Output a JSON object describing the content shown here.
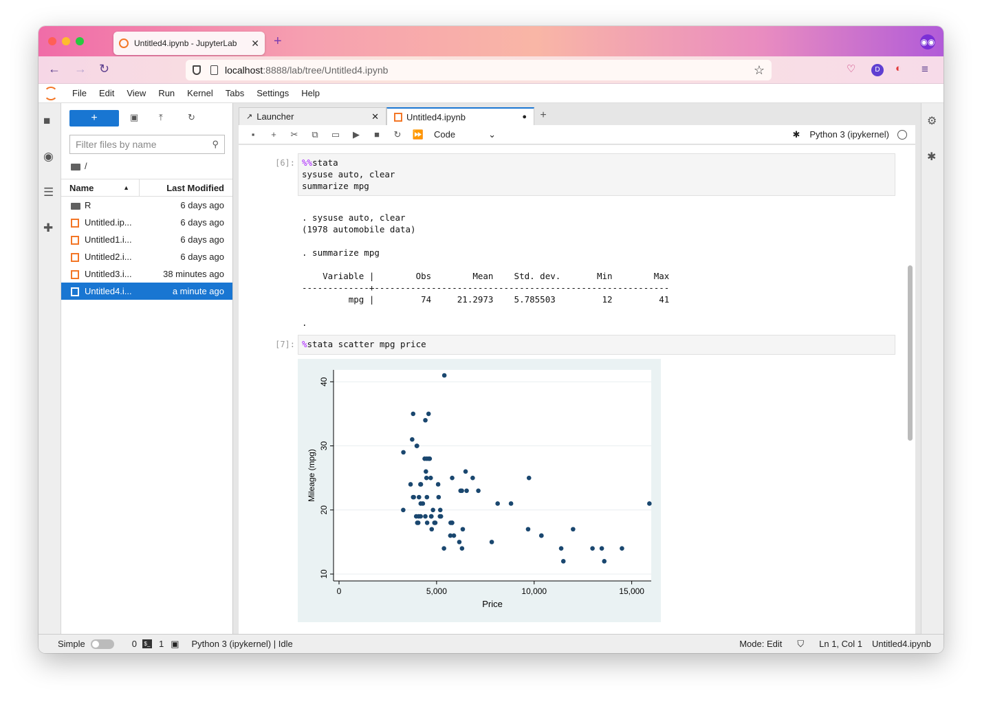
{
  "browser": {
    "tab_title": "Untitled4.ipynb - JupyterLab",
    "url_host": "localhost",
    "url_rest": ":8888/lab/tree/Untitled4.ipynb",
    "avatar_letter": "D"
  },
  "menubar": {
    "items": [
      "File",
      "Edit",
      "View",
      "Run",
      "Kernel",
      "Tabs",
      "Settings",
      "Help"
    ]
  },
  "filebrowser": {
    "new_label": "+",
    "filter_placeholder": "Filter files by name",
    "breadcrumb": "/",
    "col_name": "Name",
    "col_modified": "Last Modified",
    "files": [
      {
        "name": "R",
        "modified": "6 days ago",
        "type": "folder"
      },
      {
        "name": "Untitled.ip...",
        "modified": "6 days ago",
        "type": "notebook"
      },
      {
        "name": "Untitled1.i...",
        "modified": "6 days ago",
        "type": "notebook"
      },
      {
        "name": "Untitled2.i...",
        "modified": "6 days ago",
        "type": "notebook"
      },
      {
        "name": "Untitled3.i...",
        "modified": "38 minutes ago",
        "type": "notebook"
      },
      {
        "name": "Untitled4.i...",
        "modified": "a minute ago",
        "type": "notebook",
        "selected": true
      }
    ]
  },
  "doc_tabs": [
    {
      "label": "Launcher"
    },
    {
      "label": "Untitled4.ipynb"
    }
  ],
  "toolbar": {
    "cell_type": "Code",
    "kernel": "Python 3 (ipykernel)"
  },
  "cells": {
    "cell6": {
      "prompt": "[6]:",
      "magic": "%%",
      "line1": "stata",
      "line2": "sysuse auto, clear",
      "line3": "summarize mpg",
      "output": ". sysuse auto, clear\n(1978 automobile data)\n\n. summarize mpg\n\n    Variable |        Obs        Mean    Std. dev.       Min        Max\n-------------+---------------------------------------------------------\n         mpg |         74     21.2973    5.785503         12         41\n\n."
    },
    "cell7": {
      "prompt": "[7]:",
      "magic": "%",
      "code": "stata scatter mpg price"
    }
  },
  "chart_data": {
    "type": "scatter",
    "title": "",
    "xlabel": "Price",
    "ylabel": "Mileage (mpg)",
    "xlim": [
      0,
      16000
    ],
    "ylim": [
      10,
      41
    ],
    "xticks": [
      0,
      5000,
      10000,
      15000
    ],
    "xtick_labels": [
      "0",
      "5,000",
      "10,000",
      "15,000"
    ],
    "yticks": [
      10,
      20,
      30,
      40
    ],
    "ytick_labels": [
      "10",
      "20",
      "30",
      "40"
    ],
    "grid": true,
    "color": "#1a476f",
    "points": [
      [
        4099,
        22
      ],
      [
        4749,
        17
      ],
      [
        3799,
        22
      ],
      [
        4816,
        20
      ],
      [
        7827,
        15
      ],
      [
        5788,
        18
      ],
      [
        4453,
        26
      ],
      [
        5189,
        20
      ],
      [
        10372,
        16
      ],
      [
        4082,
        19
      ],
      [
        11385,
        14
      ],
      [
        14500,
        14
      ],
      [
        15906,
        21
      ],
      [
        3299,
        29
      ],
      [
        5705,
        16
      ],
      [
        4504,
        22
      ],
      [
        5104,
        22
      ],
      [
        3667,
        24
      ],
      [
        3955,
        19
      ],
      [
        3984,
        30
      ],
      [
        4010,
        18
      ],
      [
        5886,
        16
      ],
      [
        6342,
        17
      ],
      [
        4389,
        28
      ],
      [
        4187,
        21
      ],
      [
        11497,
        12
      ],
      [
        13594,
        12
      ],
      [
        13466,
        14
      ],
      [
        3829,
        22
      ],
      [
        5379,
        14
      ],
      [
        6165,
        15
      ],
      [
        4516,
        18
      ],
      [
        6303,
        14
      ],
      [
        3291,
        20
      ],
      [
        8814,
        21
      ],
      [
        5172,
        19
      ],
      [
        4733,
        19
      ],
      [
        4890,
        18
      ],
      [
        4181,
        19
      ],
      [
        4195,
        24
      ],
      [
        10371,
        16
      ],
      [
        4647,
        28
      ],
      [
        4425,
        34
      ],
      [
        4482,
        25
      ],
      [
        6486,
        26
      ],
      [
        4060,
        18
      ],
      [
        5798,
        18
      ],
      [
        4934,
        18
      ],
      [
        5222,
        19
      ],
      [
        4723,
        19
      ],
      [
        4424,
        19
      ],
      [
        4172,
        24
      ],
      [
        9690,
        17
      ],
      [
        6295,
        23
      ],
      [
        9735,
        25
      ],
      [
        6229,
        23
      ],
      [
        4589,
        35
      ],
      [
        5079,
        24
      ],
      [
        8129,
        21
      ],
      [
        4296,
        21
      ],
      [
        5799,
        25
      ],
      [
        4499,
        28
      ],
      [
        3995,
        30
      ],
      [
        12990,
        14
      ],
      [
        3748,
        31
      ],
      [
        5719,
        18
      ],
      [
        7140,
        23
      ],
      [
        5397,
        41
      ],
      [
        4697,
        25
      ],
      [
        6850,
        25
      ],
      [
        11995,
        17
      ],
      [
        6540,
        23
      ],
      [
        3798,
        35
      ],
      [
        4600,
        28
      ]
    ]
  },
  "statusbar": {
    "mode_label": "Simple",
    "count0": "0",
    "count1": "1",
    "kernel_status": "Python 3 (ipykernel) | Idle",
    "mode": "Mode: Edit",
    "position": "Ln 1, Col 1",
    "filename": "Untitled4.ipynb"
  }
}
